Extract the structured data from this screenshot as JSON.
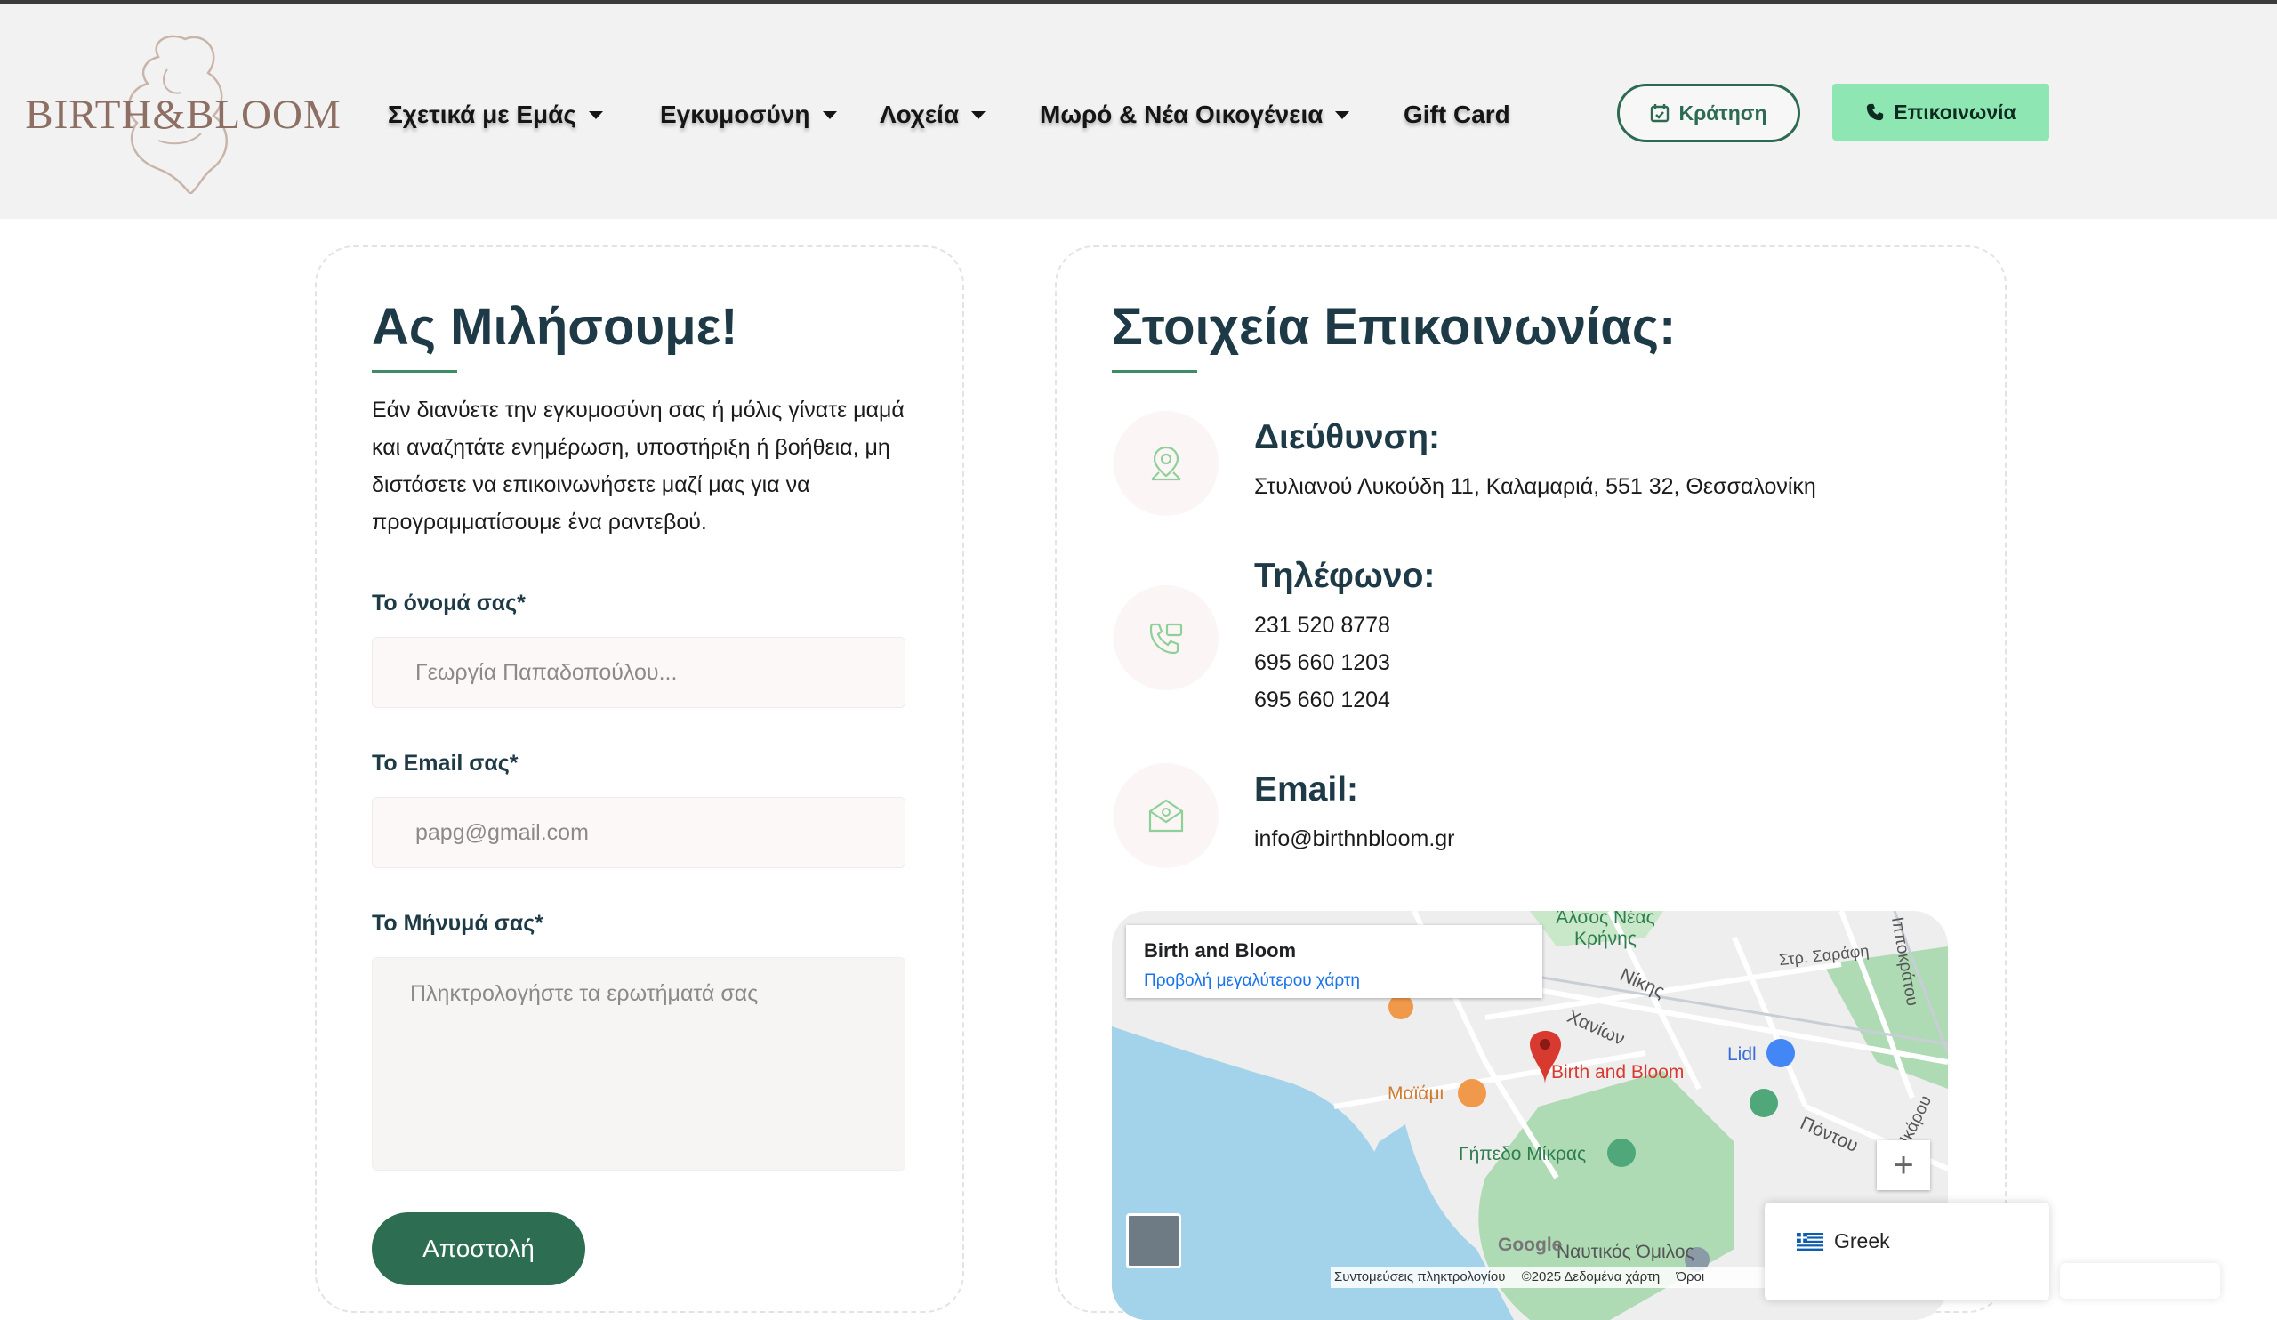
{
  "header": {
    "logo_text": "BIRTH&BLOOM",
    "nav": [
      {
        "label": "Σχετικά με Εμάς",
        "has_dropdown": true
      },
      {
        "label": "Εγκυμοσύνη",
        "has_dropdown": true
      },
      {
        "label": "Λοχεία",
        "has_dropdown": true
      },
      {
        "label": "Μωρό & Νέα Οικογένεια",
        "has_dropdown": true
      },
      {
        "label": "Gift Card",
        "has_dropdown": false
      }
    ],
    "book_button": "Κράτηση",
    "contact_button": "Επικοινωνία"
  },
  "form": {
    "title": "Ας Μιλήσουμε!",
    "intro": "Εάν διανύετε την εγκυμοσύνη σας ή μόλις γίνατε μαμά και αναζητάτε ενημέρωση, υποστήριξη ή βοήθεια, μη διστάσετε να επικοινωνήσετε μαζί μας για να προγραμματίσουμε ένα ραντεβού.",
    "name_label": "Το όνομά σας*",
    "name_placeholder": "Γεωργία Παπαδοπούλου...",
    "email_label": "Το Email σας*",
    "email_placeholder": "papg@gmail.com",
    "message_label": "Το Μήνυμά σας*",
    "message_placeholder": "Πληκτρολογήστε τα ερωτήματά σας",
    "submit": "Αποστολή"
  },
  "contact": {
    "title": "Στοιχεία Επικοινωνίας:",
    "address_title": "Διεύθυνση:",
    "address": "Στυλιανού Λυκούδη 11, Καλαμαριά, 551 32, Θεσσαλονίκη",
    "phone_title": "Τηλέφωνο:",
    "phones": [
      "231 520 8778",
      "695 660 1203",
      "695 660 1204"
    ],
    "email_title": "Email:",
    "email": "info@birthnbloom.gr"
  },
  "map": {
    "place_name": "Birth and Bloom",
    "larger_map_link": "Προβολή μεγαλύτερου χάρτη",
    "labels": {
      "grove": "Άλσος Νέας Κρήνης",
      "nikis": "Νίκης",
      "chanion": "Χανίων",
      "str_sarafi": "Στρ. Σαράφη",
      "ippokratous": "Ιπποκράτου",
      "lidl": "Lidl",
      "marker": "Birth and Bloom",
      "maiami": "Μαϊάμι",
      "pontou": "Πόντου",
      "ikarou": "Ικάρου",
      "gipedo": "Γήπεδο Μίκρας",
      "omilos": "Ναυτικός Όμιλος",
      "google": "Google"
    },
    "footer": [
      "Συντομεύσεις πληκτρολογίου",
      "©2025 Δεδομένα χάρτη",
      "Όροι"
    ],
    "colors": {
      "water": "#a3d3ea",
      "park": "#aedab4",
      "land": "#eeeeee",
      "marker": "#d93a2f"
    }
  },
  "language": {
    "label": "Greek"
  },
  "colors": {
    "accent": "#2d6e52",
    "contact_button": "#8ee7b3",
    "title": "#1e3a47",
    "logo": "#8d6f63"
  }
}
